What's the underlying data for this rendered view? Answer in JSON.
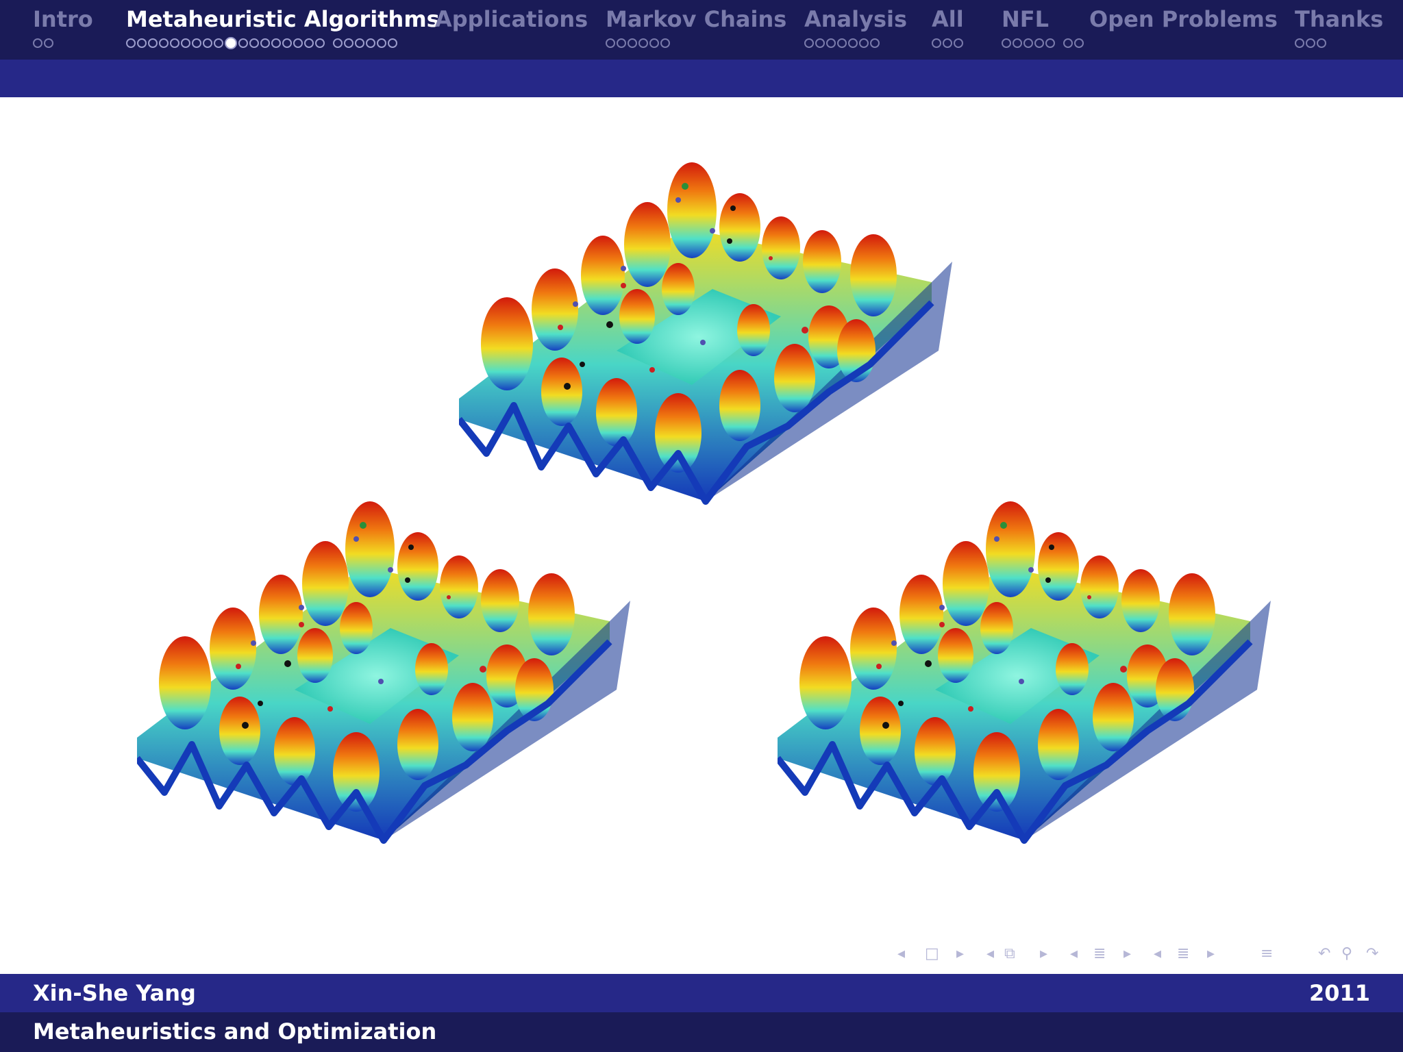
{
  "nav": {
    "sections": [
      {
        "title": "Intro",
        "dots": [
          2
        ],
        "active": false
      },
      {
        "title": "Metaheuristic Algorithms",
        "dots": [
          18,
          6
        ],
        "current_dot": 9,
        "active": true
      },
      {
        "title": "Applications",
        "dots": [],
        "active": false
      },
      {
        "title": "Markov Chains",
        "dots": [
          6
        ],
        "active": false
      },
      {
        "title": "Analysis",
        "dots": [
          7
        ],
        "active": false
      },
      {
        "title": "All",
        "dots": [
          3
        ],
        "active": false
      },
      {
        "title": "NFL",
        "dots": [
          5,
          2
        ],
        "active": false
      },
      {
        "title": "Open Problems",
        "dots": [],
        "active": false
      },
      {
        "title": "Thanks",
        "dots": [
          3
        ],
        "active": false
      }
    ]
  },
  "footer": {
    "author": "Xin-She Yang",
    "year": "2011",
    "title": "Metaheuristics and Optimization"
  },
  "figure": {
    "icon": "multimodal-surface-landscape",
    "panels": 3,
    "colors": {
      "peak": "#d02010",
      "mid": "#f0d020",
      "valley": "#1a3fc0",
      "flat": "#40e0d0"
    }
  },
  "controls": {
    "icons": [
      "frame-prev-arrow",
      "frame-icon",
      "frame-next-arrow",
      "subsection-prev-arrow",
      "subsection-icon",
      "subsection-next-arrow",
      "section-prev-arrow",
      "section-icon",
      "section-next-arrow",
      "slide-prev-arrow",
      "slide-icon",
      "slide-next-arrow",
      "outline-icon",
      "undo-icon",
      "search-icon",
      "redo-icon"
    ]
  },
  "theme": {
    "nav_bg": "#1a1b57",
    "bar_bg": "#262888",
    "inactive_text": "#7a7bab",
    "active_text": "#ffffff"
  }
}
